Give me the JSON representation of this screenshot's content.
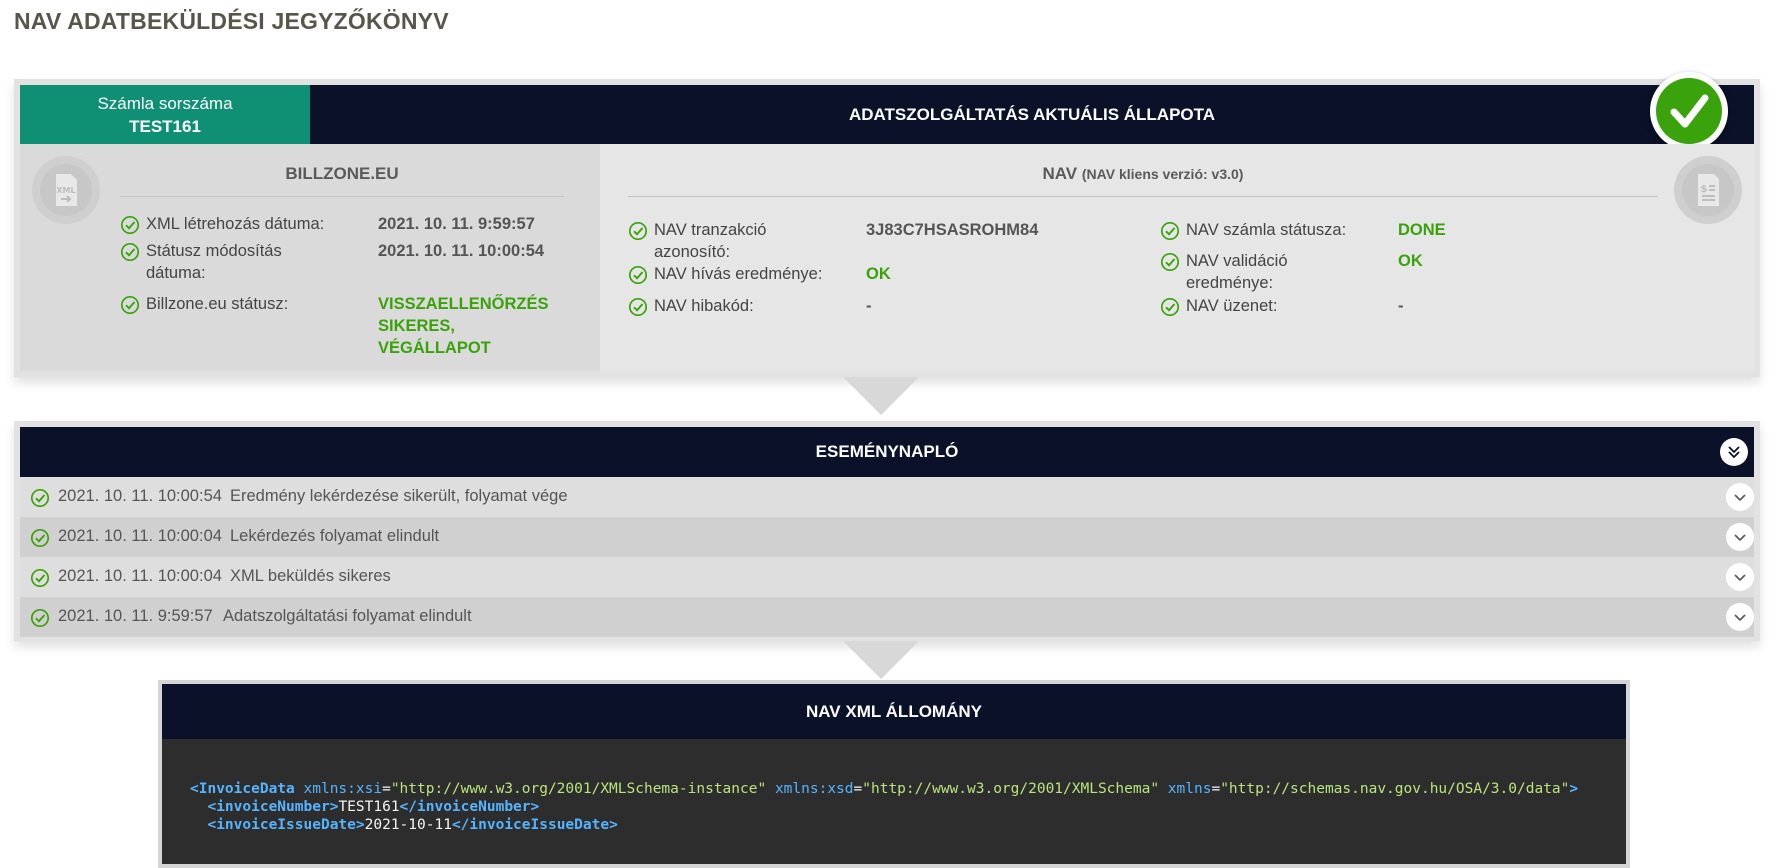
{
  "page": {
    "title": "NAV ADATBEKÜLDÉSI JEGYZŐKÖNYV"
  },
  "status_card": {
    "invoice_label": "Számla sorszáma",
    "invoice_number": "TEST161",
    "title": "ADATSZOLGÁLTATÁS AKTUÁLIS ÁLLAPOTA",
    "state_icon": "success-check-icon",
    "billzone": {
      "title": "BILLZONE.EU",
      "icon": "xml-file-icon",
      "rows": [
        {
          "label": "XML létrehozás dátuma:",
          "value": "2021. 10. 11. 9:59:57"
        },
        {
          "label_line1": "Státusz módosítás",
          "label_line2": "dátuma:",
          "value": "2021. 10. 11. 10:00:54"
        },
        {
          "label": "Billzone.eu státusz:",
          "value_line1": "VISSZAELLENŐRZÉS",
          "value_line2": "SIKERES, VÉGÁLLAPOT"
        }
      ]
    },
    "nav": {
      "title": "NAV",
      "subtitle": "(NAV kliens verzió: v3.0)",
      "icon": "invoice-document-icon",
      "left_rows": [
        {
          "label_line1": "NAV tranzakció",
          "label_line2": "azonosító:",
          "value": "3J83C7HSASROHM84"
        },
        {
          "label": "NAV hívás eredménye:",
          "value": "OK"
        },
        {
          "label": "NAV hibakód:",
          "value": "-"
        }
      ],
      "right_rows": [
        {
          "label": "NAV számla státusza:",
          "value": "DONE"
        },
        {
          "label_line1": "NAV validáció",
          "label_line2": "eredménye:",
          "value": "OK"
        },
        {
          "label": "NAV üzenet:",
          "value": "-"
        }
      ]
    }
  },
  "events": {
    "title": "ESEMÉNYNAPLÓ",
    "items": [
      {
        "time": "2021. 10. 11. 10:00:54",
        "message": "Eredmény lekérdezése sikerült, folyamat vége"
      },
      {
        "time": "2021. 10. 11. 10:00:04",
        "message": "Lekérdezés folyamat elindult"
      },
      {
        "time": "2021. 10. 11. 10:00:04",
        "message": "XML beküldés sikeres"
      },
      {
        "time": "2021. 10. 11. 9:59:57",
        "message": "Adatszolgáltatási folyamat elindult"
      }
    ]
  },
  "xml": {
    "title": "NAV XML ÁLLOMÁNY",
    "root_tag": "InvoiceData",
    "attr_xsi_name": "xmlns:xsi",
    "attr_xsi_value": "\"http://www.w3.org/2001/XMLSchema-instance\"",
    "attr_xsd_name": "xmlns:xsd",
    "attr_xsd_value": "\"http://www.w3.org/2001/XMLSchema\"",
    "attr_ns_name": "xmlns",
    "attr_ns_value": "\"http://schemas.nav.gov.hu/OSA/3.0/data\"",
    "invoice_number_tag": "invoiceNumber",
    "invoice_number_value": "TEST161",
    "issue_date_tag": "invoiceIssueDate",
    "issue_date_value": "2021-10-11"
  },
  "colors": {
    "navy": "#0a1129",
    "teal": "#0f8f74",
    "green": "#3aa20b"
  }
}
